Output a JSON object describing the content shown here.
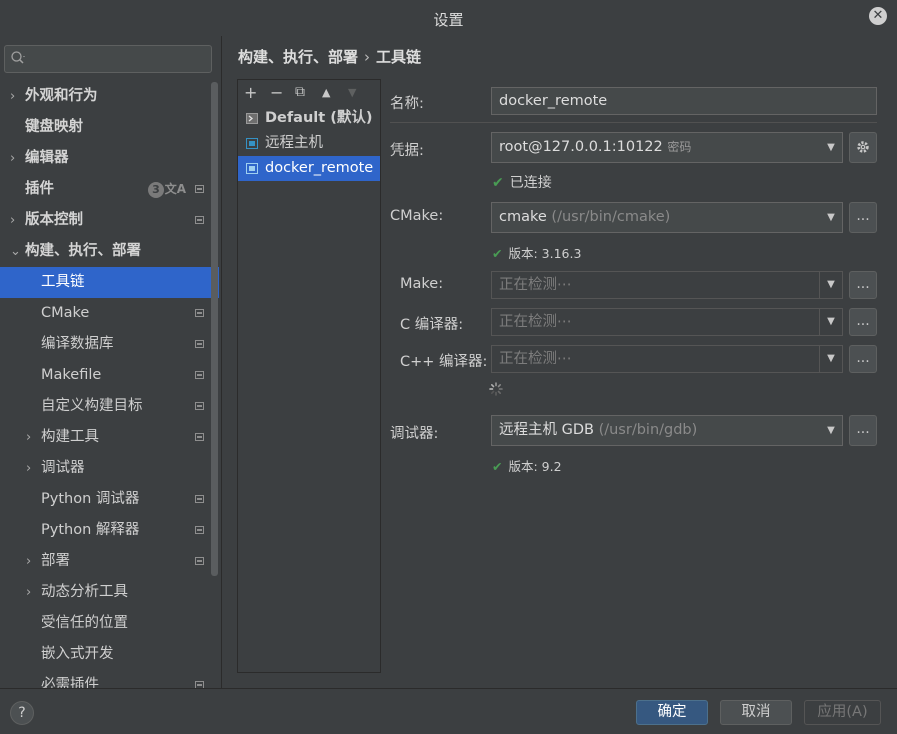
{
  "window": {
    "title": "设置",
    "close_glyph": "✕"
  },
  "search": {
    "placeholder": ""
  },
  "sidebar": {
    "items": [
      {
        "label": "外观和行为",
        "chevron": "›"
      },
      {
        "label": "键盘映射"
      },
      {
        "label": "编辑器",
        "chevron": "›"
      },
      {
        "label": "插件",
        "badge": "3",
        "translate_glyph": "文A"
      },
      {
        "label": "版本控制",
        "chevron": "›"
      },
      {
        "label": "构建、执行、部署",
        "chevron": "⌄"
      },
      {
        "label": "工具链"
      },
      {
        "label": "CMake"
      },
      {
        "label": "编译数据库"
      },
      {
        "label": "Makefile"
      },
      {
        "label": "自定义构建目标"
      },
      {
        "label": "构建工具",
        "chevron": "›"
      },
      {
        "label": "调试器",
        "chevron": "›"
      },
      {
        "label": "Python 调试器"
      },
      {
        "label": "Python 解释器"
      },
      {
        "label": "部署",
        "chevron": "›"
      },
      {
        "label": "动态分析工具",
        "chevron": "›"
      },
      {
        "label": "受信任的位置"
      },
      {
        "label": "嵌入式开发"
      },
      {
        "label": "必需插件"
      }
    ]
  },
  "breadcrumb": {
    "parent": "构建、执行、部署",
    "separator": "›",
    "current": "工具链"
  },
  "toolchains": {
    "toolbar": {
      "add": "+",
      "remove": "−",
      "copy": "⧉",
      "up": "▲",
      "down": "▼"
    },
    "items": [
      {
        "label": "Default (默认)"
      },
      {
        "label": "远程主机"
      },
      {
        "label": "docker_remote"
      }
    ]
  },
  "form": {
    "name_label": "名称:",
    "name_value": "docker_remote",
    "credentials_label": "凭据:",
    "credentials_value": "root@127.0.0.1:10122",
    "credentials_suffix": "密码",
    "credentials_status": "已连接",
    "cmake_label": "CMake:",
    "cmake_value": "cmake",
    "cmake_path": "(/usr/bin/cmake)",
    "cmake_status": "版本: 3.16.3",
    "make_label": "Make:",
    "make_value": "正在检测⋯",
    "c_compiler_label": "C 编译器:",
    "c_compiler_value": "正在检测⋯",
    "cpp_compiler_label": "C++ 编译器:",
    "cpp_compiler_value": "正在检测⋯",
    "debugger_label": "调试器:",
    "debugger_value": "远程主机 GDB",
    "debugger_path": "(/usr/bin/gdb)",
    "debugger_status": "版本: 9.2",
    "browse": "...",
    "check": "✔",
    "dropdown": "▼"
  },
  "footer": {
    "help": "?",
    "ok": "确定",
    "cancel": "取消",
    "apply": "应用(A)"
  },
  "colors": {
    "selection": "#2f65ca",
    "check": "#499c54",
    "primary_button": "#365880"
  }
}
